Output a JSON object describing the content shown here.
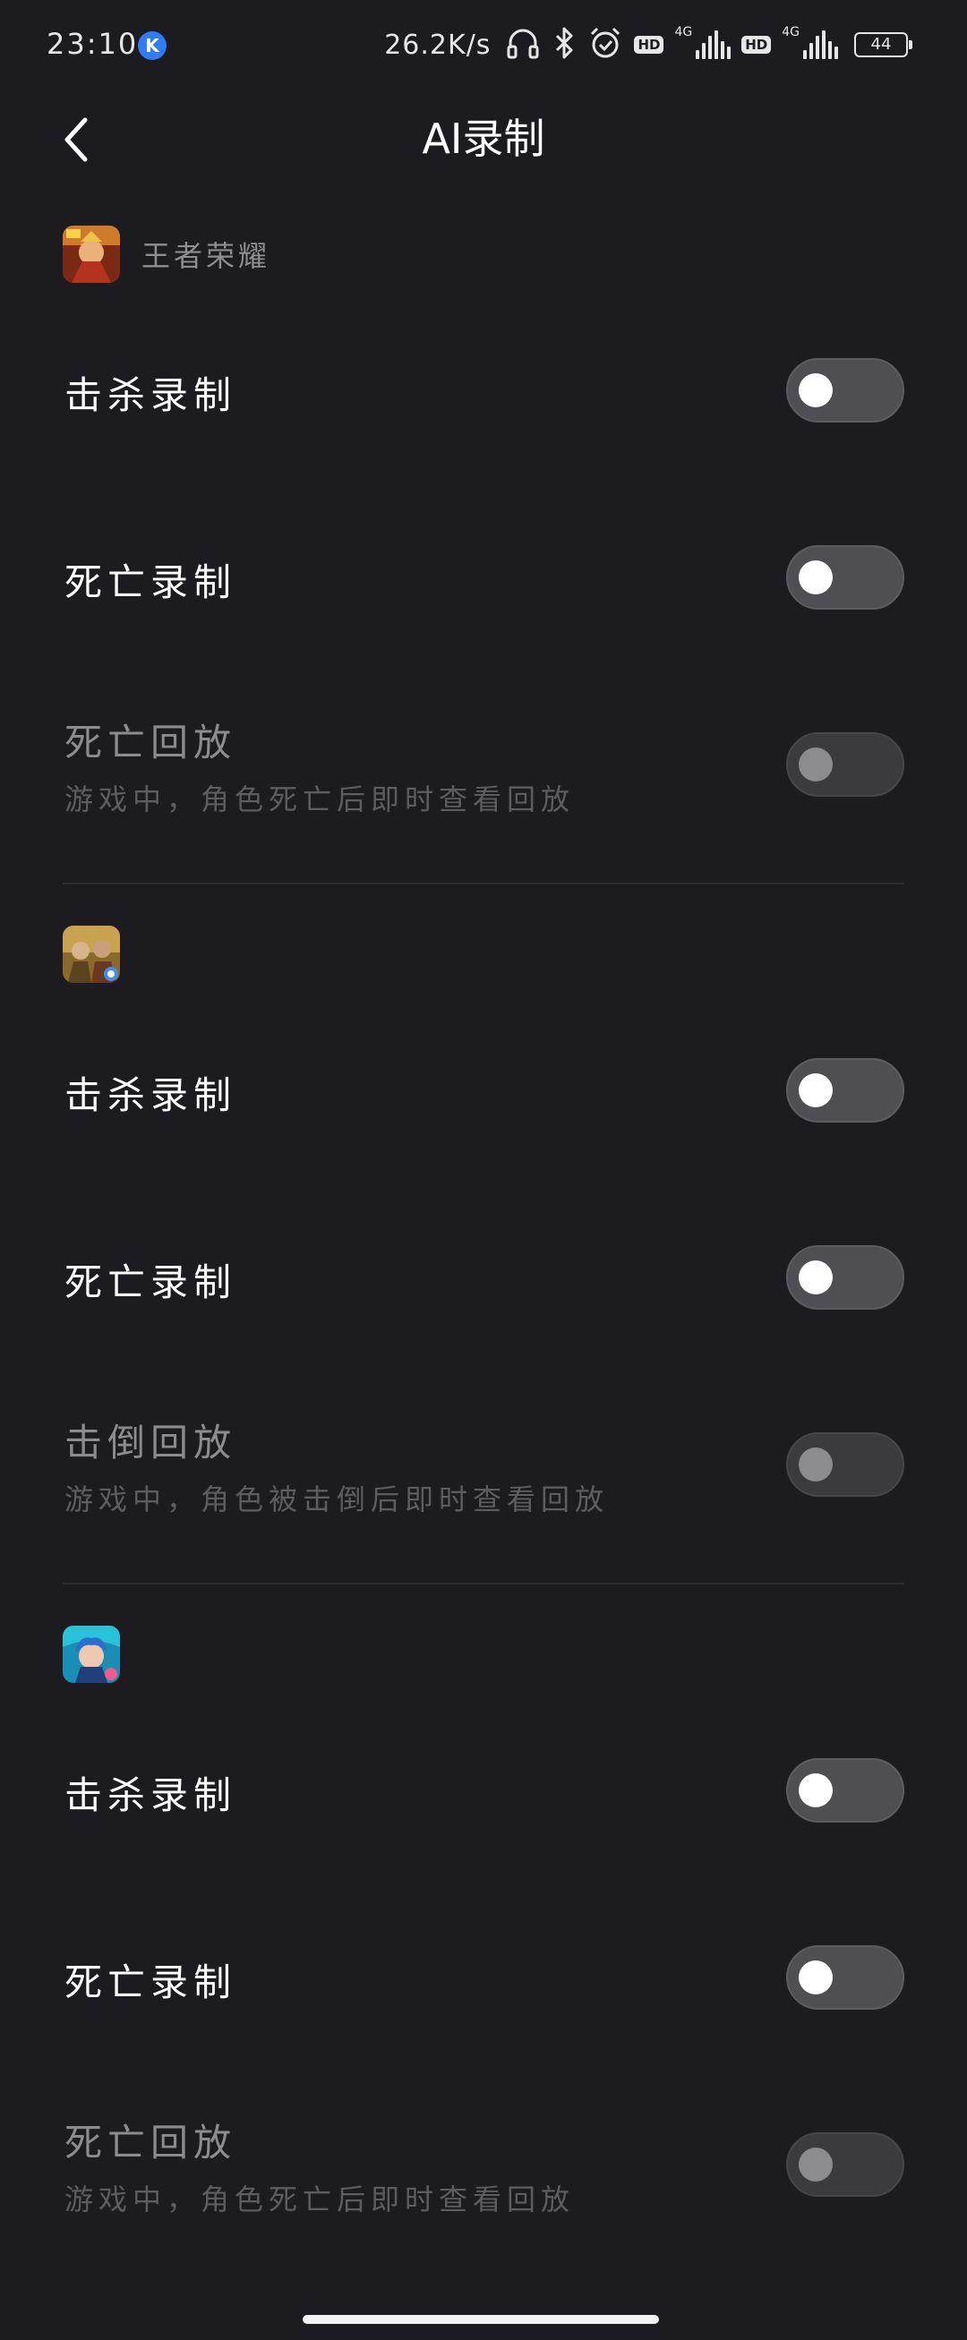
{
  "status_bar": {
    "time": "23:10",
    "app_badge": "K",
    "net_speed": "26.2K/s",
    "hd_label": "HD",
    "net_type": "4G",
    "battery": "44",
    "icons": [
      "headphones-icon",
      "bluetooth-icon",
      "alarm-icon",
      "hd-icon",
      "signal-icon",
      "hd-icon",
      "signal-icon",
      "battery-icon"
    ]
  },
  "header": {
    "title": "AI录制",
    "back_icon": "chevron-left-icon"
  },
  "sections": [
    {
      "game_name": "王者荣耀",
      "icon": "honor-of-kings-icon",
      "rows": [
        {
          "title": "击杀录制",
          "subtitle": "",
          "enabled": false,
          "dimmed": false
        },
        {
          "title": "死亡录制",
          "subtitle": "",
          "enabled": false,
          "dimmed": false
        },
        {
          "title": "死亡回放",
          "subtitle": "游戏中，角色死亡后即时查看回放",
          "enabled": false,
          "dimmed": true
        }
      ]
    },
    {
      "game_name": "",
      "icon": "pubg-mobile-icon",
      "rows": [
        {
          "title": "击杀录制",
          "subtitle": "",
          "enabled": false,
          "dimmed": false
        },
        {
          "title": "死亡录制",
          "subtitle": "",
          "enabled": false,
          "dimmed": false
        },
        {
          "title": "击倒回放",
          "subtitle": "游戏中，角色被击倒后即时查看回放",
          "enabled": false,
          "dimmed": true
        }
      ]
    },
    {
      "game_name": "",
      "icon": "league-of-legends-icon",
      "rows": [
        {
          "title": "击杀录制",
          "subtitle": "",
          "enabled": false,
          "dimmed": false
        },
        {
          "title": "死亡录制",
          "subtitle": "",
          "enabled": false,
          "dimmed": false
        },
        {
          "title": "死亡回放",
          "subtitle": "游戏中，角色死亡后即时查看回放",
          "enabled": false,
          "dimmed": true
        }
      ]
    }
  ],
  "colors": {
    "background": "#1c1c20",
    "text_primary": "#ffffff",
    "text_dim": "#8b8b90",
    "text_sub": "#5c5c61",
    "toggle_track": "#4e4e53",
    "toggle_knob": "#ffffff",
    "divider": "#2b2b30"
  }
}
